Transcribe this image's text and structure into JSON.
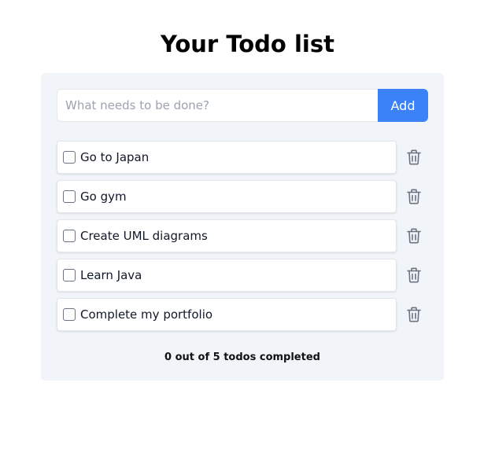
{
  "header": {
    "title": "Your Todo list"
  },
  "add_form": {
    "input_value": "",
    "placeholder": "What needs to be done?",
    "add_label": "Add"
  },
  "todos": [
    {
      "text": "Go to Japan",
      "completed": false
    },
    {
      "text": "Go gym",
      "completed": false
    },
    {
      "text": "Create UML diagrams",
      "completed": false
    },
    {
      "text": "Learn Java",
      "completed": false
    },
    {
      "text": "Complete my portfolio",
      "completed": false
    }
  ],
  "footer": {
    "summary": "0 out of 5 todos completed"
  },
  "icons": {
    "delete": "trash-icon",
    "checkbox": "checkbox-unchecked-icon"
  },
  "colors": {
    "accent": "#3b82f6",
    "card_background": "#f1f4f9",
    "icon": "#6b7280"
  }
}
